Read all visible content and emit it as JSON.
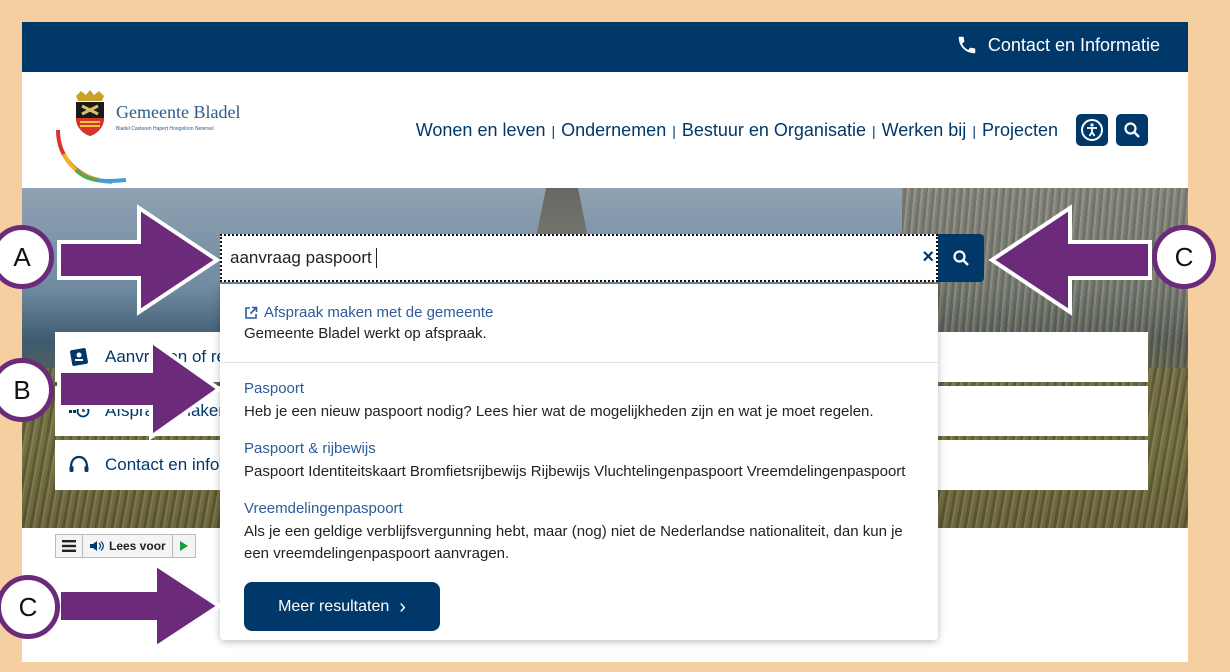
{
  "header": {
    "contact_label": "Contact en Informatie",
    "logo_name": "Gemeente Bladel",
    "logo_sub": "Bladel  Casteren  Hapert  Hoogeloon  Netersel"
  },
  "nav": {
    "items": [
      "Wonen en leven",
      "Ondernemen",
      "Bestuur en Organisatie",
      "Werken bij",
      "Projecten"
    ],
    "separator": "|"
  },
  "search": {
    "query": "aanvraag paspoort",
    "clear_icon": "×"
  },
  "dropdown": {
    "top": {
      "title": "Afspraak maken met de gemeente",
      "desc": "Gemeente Bladel werkt op afspraak."
    },
    "results": [
      {
        "title": "Paspoort",
        "desc": "Heb je een nieuw paspoort nodig? Lees hier wat de mogelijkheden zijn en wat je moet regelen."
      },
      {
        "title": "Paspoort & rijbewijs",
        "desc": "Paspoort Identiteitskaart Bromfietsrijbewijs Rijbewijs Vluchtelingenpaspoort Vreemdelingenpaspoort"
      },
      {
        "title": "Vreemdelingenpaspoort",
        "desc": "Als je een geldige verblijfsvergunning hebt, maar (nog) niet de Nederlandse nationaliteit, dan kun je een vreemdelingenpaspoort aanvragen."
      }
    ],
    "more_label": "Meer resultaten",
    "more_chevron": "›"
  },
  "quick_links": [
    {
      "label": "Aanvragen of re",
      "icon": "id-card-icon"
    },
    {
      "label": "Afspraak maken",
      "icon": "calendar-clock-icon"
    },
    {
      "label": "Contact en info",
      "icon": "headset-icon"
    }
  ],
  "leesvoor": {
    "label": "Lees voor"
  },
  "annotations": {
    "a": "A",
    "b": "B",
    "c1": "C",
    "c2": "C"
  },
  "colors": {
    "brand": "#00386a",
    "link": "#2c5c9a",
    "annotation_arrow": "#6b2a7a",
    "frame": "#f5cfa0"
  }
}
